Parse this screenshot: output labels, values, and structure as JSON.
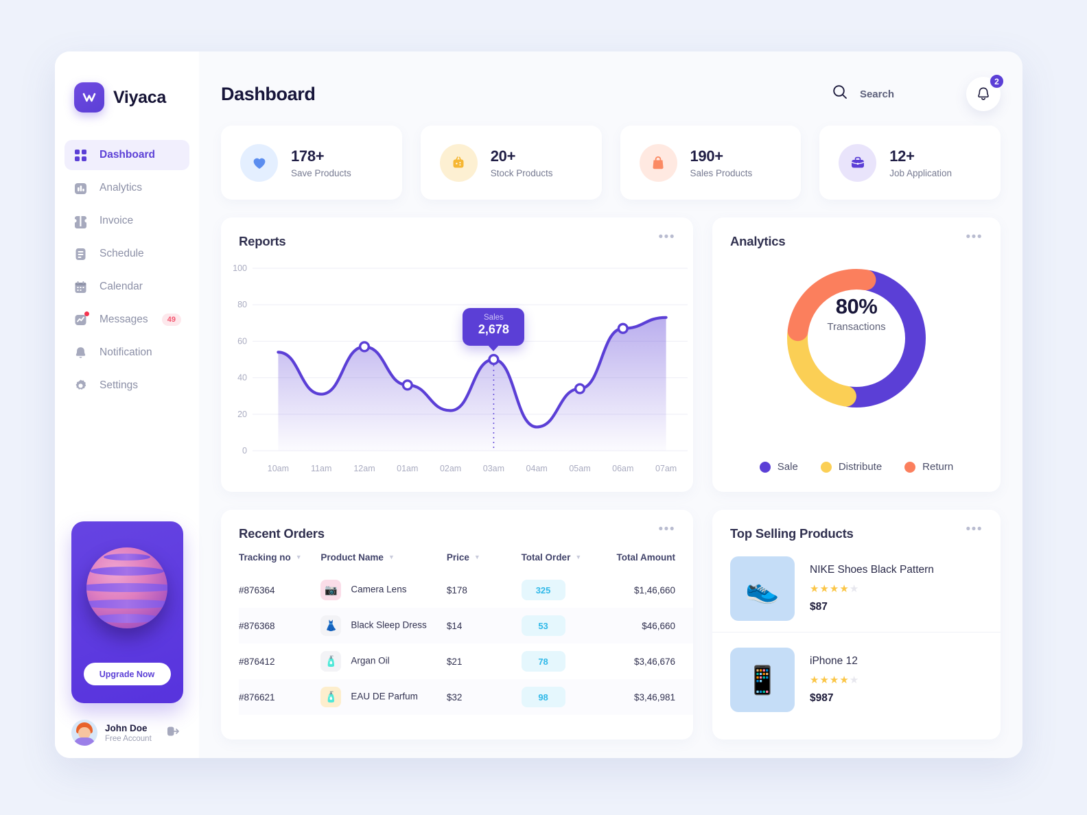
{
  "brand": {
    "name": "Viyaca",
    "logo_icon": "viyaca-logo-icon"
  },
  "sidebar": {
    "items": [
      {
        "label": "Dashboard",
        "icon": "grid-icon",
        "active": true
      },
      {
        "label": "Analytics",
        "icon": "bar-chart-icon",
        "active": false
      },
      {
        "label": "Invoice",
        "icon": "ticket-icon",
        "active": false
      },
      {
        "label": "Schedule",
        "icon": "list-icon",
        "active": false
      },
      {
        "label": "Calendar",
        "icon": "calendar-icon",
        "active": false
      },
      {
        "label": "Messages",
        "icon": "chat-line-icon",
        "active": false,
        "badge": "49",
        "dot": true
      },
      {
        "label": "Notification",
        "icon": "bell-icon",
        "active": false
      },
      {
        "label": "Settings",
        "icon": "gear-icon",
        "active": false
      }
    ],
    "upgrade": {
      "button_label": "Upgrade Now"
    },
    "user": {
      "name": "John Doe",
      "plan": "Free Account",
      "logout_icon": "logout-icon"
    }
  },
  "header": {
    "title": "Dashboard",
    "search": {
      "label": "Search",
      "icon": "search-icon"
    },
    "notification": {
      "icon": "bell-icon",
      "count": "2"
    }
  },
  "stats": [
    {
      "value": "178+",
      "label": "Save Products",
      "icon": "heart-icon",
      "icon_color": "#5b8def",
      "bg": "#e4efff"
    },
    {
      "value": "20+",
      "label": "Stock Products",
      "icon": "box-icon",
      "icon_color": "#f6b733",
      "bg": "#fdf0d2"
    },
    {
      "value": "190+",
      "label": "Sales Products",
      "icon": "bag-icon",
      "icon_color": "#fb8a63",
      "bg": "#ffe9e1"
    },
    {
      "value": "12+",
      "label": "Job Application",
      "icon": "briefcase-icon",
      "icon_color": "#5b3fd6",
      "bg": "#e9e4fb"
    }
  ],
  "reports": {
    "title": "Reports",
    "menu_icon": "more-horizontal-icon",
    "tooltip": {
      "label": "Sales",
      "value": "2,678"
    }
  },
  "analytics": {
    "title": "Analytics",
    "menu_icon": "more-horizontal-icon",
    "center_value": "80%",
    "center_label": "Transactions",
    "legend": [
      {
        "label": "Sale",
        "color": "#5b3fd6"
      },
      {
        "label": "Distribute",
        "color": "#fbcf55"
      },
      {
        "label": "Return",
        "color": "#fb7f5d"
      }
    ]
  },
  "orders": {
    "title": "Recent Orders",
    "menu_icon": "more-horizontal-icon",
    "columns": [
      {
        "label": "Tracking no",
        "sortable": true
      },
      {
        "label": "Product Name",
        "sortable": true
      },
      {
        "label": "Price",
        "sortable": true
      },
      {
        "label": "Total Order",
        "sortable": true
      },
      {
        "label": "Total Amount",
        "sortable": false
      }
    ],
    "rows": [
      {
        "tracking": "#876364",
        "product": "Camera Lens",
        "price": "$178",
        "total_order": "325",
        "total_amount": "$1,46,660",
        "thumb": "camera-lens-thumb",
        "thumb_bg": "#fbdde8",
        "glyph": "📷"
      },
      {
        "tracking": "#876368",
        "product": "Black Sleep Dress",
        "price": "$14",
        "total_order": "53",
        "total_amount": "$46,660",
        "thumb": "dress-thumb",
        "thumb_bg": "#f3f3f6",
        "glyph": "👗"
      },
      {
        "tracking": "#876412",
        "product": "Argan Oil",
        "price": "$21",
        "total_order": "78",
        "total_amount": "$3,46,676",
        "thumb": "oil-bottle-thumb",
        "thumb_bg": "#f3f3f6",
        "glyph": "🧴"
      },
      {
        "tracking": "#876621",
        "product": "EAU DE Parfum",
        "price": "$32",
        "total_order": "98",
        "total_amount": "$3,46,981",
        "thumb": "perfume-thumb",
        "thumb_bg": "#fdeecd",
        "glyph": "🧴"
      }
    ]
  },
  "top_selling": {
    "title": "Top Selling Products",
    "menu_icon": "more-horizontal-icon",
    "products": [
      {
        "name": "NIKE Shoes Black Pattern",
        "price": "$87",
        "rating": 4,
        "max_rating": 5,
        "thumb": "nike-shoe-thumb",
        "thumb_bg": "#c5ddf7",
        "glyph": "👟"
      },
      {
        "name": "iPhone 12",
        "price": "$987",
        "rating": 4,
        "max_rating": 5,
        "thumb": "iphone-thumb",
        "thumb_bg": "#c5ddf7",
        "glyph": "📱"
      }
    ]
  },
  "chart_data": {
    "type": "area",
    "title": "Reports",
    "xlabel": "",
    "ylabel": "",
    "ylim": [
      0,
      100
    ],
    "grid": true,
    "legend_position": "none",
    "categories": [
      "10am",
      "11am",
      "12am",
      "01am",
      "02am",
      "03am",
      "04am",
      "05am",
      "06am",
      "07am"
    ],
    "tick_labels_y": [
      "0",
      "20",
      "40",
      "60",
      "80",
      "100"
    ],
    "series": [
      {
        "name": "Sales",
        "values": [
          54,
          31,
          57,
          36,
          22,
          50,
          13,
          34,
          67,
          73
        ],
        "marker_indices": [
          2,
          3,
          5,
          7,
          8
        ],
        "line_color": "#5b3fd6",
        "fill_color": "#5b3fd6"
      }
    ],
    "annotation": {
      "label": "Sales",
      "value": "2,678",
      "at_category": "03am",
      "at_value": 50
    }
  },
  "donut_data": {
    "type": "pie",
    "title": "Analytics",
    "center_label": "80%",
    "center_sublabel": "Transactions",
    "labels": [
      "Sale",
      "Distribute",
      "Return"
    ],
    "values": [
      47,
      23,
      25
    ],
    "colors": [
      "#5b3fd6",
      "#fbcf55",
      "#fb7f5d"
    ],
    "track_color": "#f4f4fa",
    "legend_position": "bottom"
  }
}
